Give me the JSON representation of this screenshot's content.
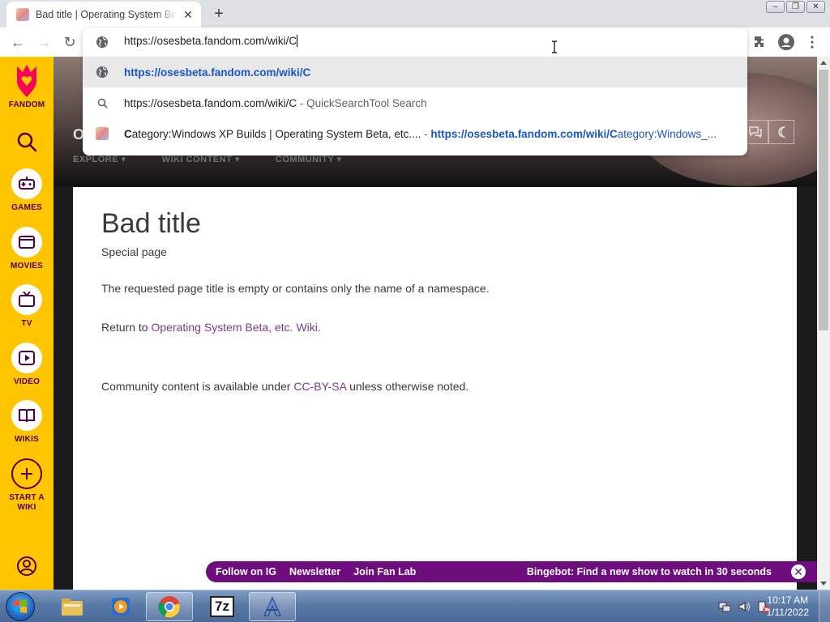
{
  "browser": {
    "tab": {
      "title": "Bad title | Operating System Beta, etc. Wiki",
      "close": "✕"
    },
    "new_tab": "+",
    "window_buttons": {
      "minimize": "–",
      "restore": "❐",
      "close": "✕"
    },
    "nav": {
      "back": "←",
      "forward": "→",
      "reload": "↻"
    }
  },
  "omnibox": {
    "input_value": "https://osesbeta.fandom.com/wiki/C",
    "suggestions": [
      {
        "text": "https://osesbeta.fandom.com/wiki/C",
        "icon": "globe-icon"
      },
      {
        "text": "https://osesbeta.fandom.com/wiki/C",
        "suffix": " - QuickSearchTool Search",
        "icon": "search-icon"
      },
      {
        "title_bold": "C",
        "title_rest": "ategory:Windows XP Builds | Operating System Beta, etc....",
        "sep": " - ",
        "url_bold": "https://osesbeta.fandom.com/wiki/C",
        "url_rest": "ategory:Windows_...",
        "icon": "wiki-favicon"
      }
    ]
  },
  "fandom_rail": {
    "logo_label": "FANDOM",
    "items": [
      {
        "label": "GAMES"
      },
      {
        "label": "MOVIES"
      },
      {
        "label": "TV"
      },
      {
        "label": "VIDEO"
      },
      {
        "label": "WIKIS"
      },
      {
        "label": "START A WIKI"
      }
    ]
  },
  "wiki_header": {
    "site_initial": "O",
    "nav": [
      "EXPLORE ▾",
      "WIKI CONTENT ▾",
      "COMMUNITY ▾"
    ]
  },
  "content": {
    "title": "Bad title",
    "subtitle": "Special page",
    "message": "The requested page title is empty or contains only the name of a namespace.",
    "return_prefix": "Return to ",
    "return_link": "Operating System Beta, etc. Wiki",
    "return_suffix": ".",
    "license_prefix": "Community content is available under ",
    "license_link": "CC-BY-SA",
    "license_suffix": " unless otherwise noted."
  },
  "promo_bar": {
    "links": [
      "Follow on IG",
      "Newsletter",
      "Join Fan Lab"
    ],
    "right_text": "Bingebot: Find a new show to watch in 30 seconds",
    "close": "✕"
  },
  "taskbar": {
    "time": "10:17 AM",
    "date": "1/11/2022",
    "apps": [
      "explorer-icon",
      "media-player-icon",
      "chrome-icon",
      "7zip-icon",
      "app-a-icon"
    ],
    "seven_zip_label": "7z"
  },
  "colors": {
    "fandom_yellow": "#ffc500",
    "fandom_purple": "#520044",
    "link_purple": "#7a3a8c",
    "promo_purple": "#6e0d7e",
    "omnibox_link": "#1a57c2"
  }
}
